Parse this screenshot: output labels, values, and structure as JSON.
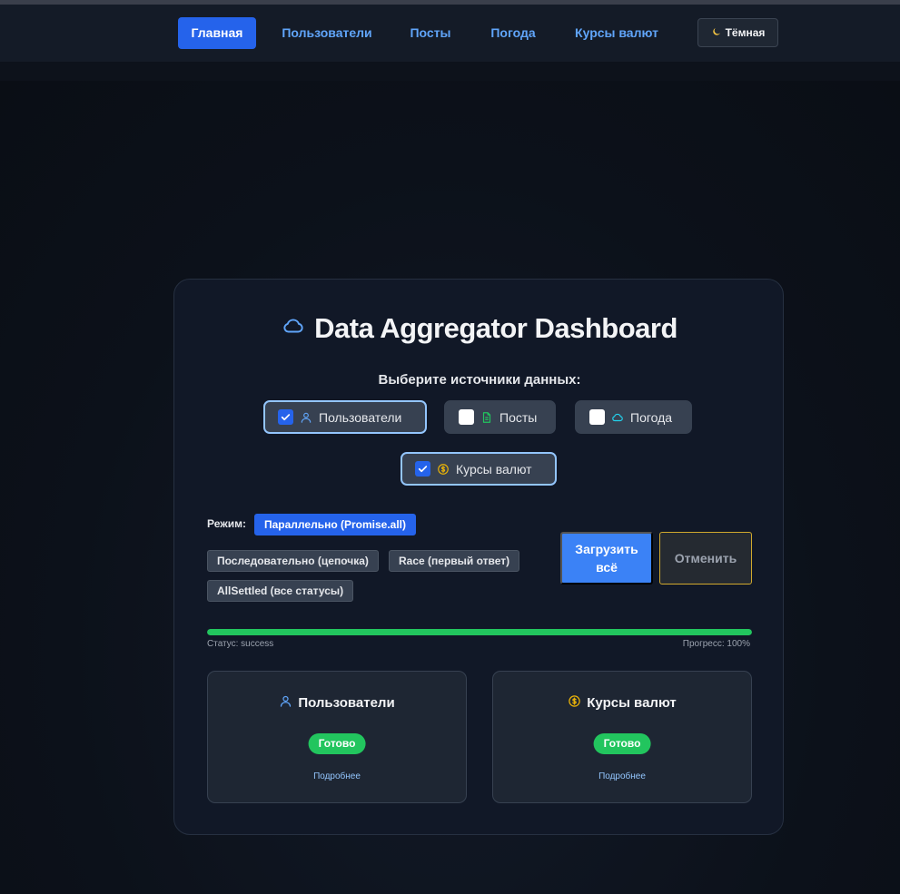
{
  "nav": {
    "items": [
      {
        "label": "Главная",
        "active": true
      },
      {
        "label": "Пользователи",
        "active": false
      },
      {
        "label": "Посты",
        "active": false
      },
      {
        "label": "Погода",
        "active": false
      },
      {
        "label": "Курсы валют",
        "active": false
      }
    ],
    "theme_toggle": {
      "icon": "moon-icon",
      "label": "Тёмная"
    }
  },
  "dashboard": {
    "title": "Data Aggregator Dashboard",
    "title_icon": "cloud-icon",
    "sources_heading": "Выберите источники данных:",
    "sources": [
      {
        "label": "Пользователи",
        "checked": true,
        "icon": "user-icon",
        "icon_color": "#60a5fa"
      },
      {
        "label": "Посты",
        "checked": false,
        "icon": "document-icon",
        "icon_color": "#22c55e"
      },
      {
        "label": "Погода",
        "checked": false,
        "icon": "cloud-icon",
        "icon_color": "#22d3ee"
      },
      {
        "label": "Курсы валют",
        "checked": true,
        "icon": "dollar-coin-icon",
        "icon_color": "#eab308"
      }
    ],
    "mode": {
      "label": "Режим:",
      "options": [
        {
          "label": "Параллельно (Promise.all)",
          "active": true
        },
        {
          "label": "Последовательно (цепочка)",
          "active": false
        },
        {
          "label": "Race (первый ответ)",
          "active": false
        },
        {
          "label": "AllSettled (все статусы)",
          "active": false
        }
      ]
    },
    "load_button": "Загрузить всё",
    "cancel_button": "Отменить",
    "progress": {
      "status_text": "Статус: success",
      "progress_text": "Прогресс: 100%",
      "value": 1.0
    },
    "results": [
      {
        "title": "Пользователи",
        "icon": "user-icon",
        "badge": "Готово",
        "link": "Подробнее"
      },
      {
        "title": "Курсы валют",
        "icon": "dollar-coin-icon",
        "badge": "Готово",
        "link": "Подробнее"
      }
    ]
  },
  "colors": {
    "accent": "#2563eb",
    "link": "#60a5fa",
    "success": "#22c55e",
    "cancel_border": "#d1a92d"
  }
}
